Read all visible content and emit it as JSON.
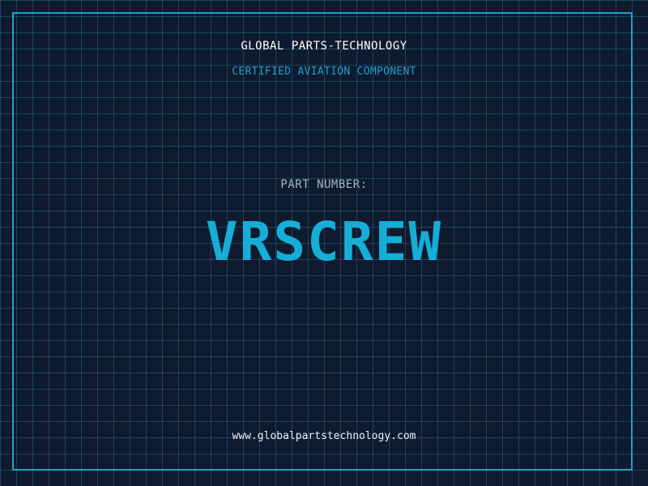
{
  "header": {
    "brand": "GLOBAL PARTS-TECHNOLOGY",
    "tagline": "CERTIFIED AVIATION COMPONENT"
  },
  "part": {
    "label": "PART NUMBER:",
    "number": "VRSCREW"
  },
  "footer": {
    "url": "www.globalpartstechnology.com"
  },
  "colors": {
    "background": "#0f1a2e",
    "accent": "#1aa3cc",
    "part_number": "#15aed6",
    "grid": "#288caa"
  }
}
